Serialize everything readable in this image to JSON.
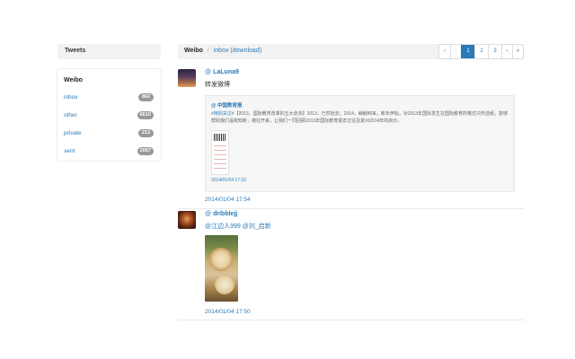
{
  "sidebar": {
    "header": "Tweets",
    "section_title": "Weibo",
    "items": [
      {
        "label": "inbox",
        "count": "862"
      },
      {
        "label": "other",
        "count": "6610"
      },
      {
        "label": "private",
        "count": "213"
      },
      {
        "label": "sent",
        "count": "2057"
      }
    ]
  },
  "breadcrumb": {
    "root": "Weibo",
    "separator": "/",
    "current": "inbox",
    "action": "(download)"
  },
  "pagination": {
    "first": "«",
    "prev": "‹",
    "pages": [
      "1",
      "2",
      "3"
    ],
    "active_page": "1",
    "next": "›",
    "last": "»"
  },
  "tweets": [
    {
      "avatar_icon": "avatar-sunset",
      "at": "@",
      "user": "LaLuna9",
      "text": "转发微博",
      "retweet": {
        "user": "@ 中国教育报",
        "tag": "#特别关注#",
        "text": "【2013，国际教育改革的五大走向】2013，已然逝去；2014，翩翩到来，新年伊始，对2013年国际发生在国际教育的格式只所选纸，能够帮助我们温故知新，继往开来，让我们一同回顾2013年国际教育报去过往及其对2014年的启示。",
        "time": "2014/01/04 17:10"
      },
      "time": "2014/01/04 17:54"
    },
    {
      "avatar_icon": "avatar-lights",
      "at": "@",
      "user": "dribblejj",
      "mentions": [
        "@江边人999",
        "@刘_启新"
      ],
      "time": "2014/01/04 17:50"
    }
  ]
}
